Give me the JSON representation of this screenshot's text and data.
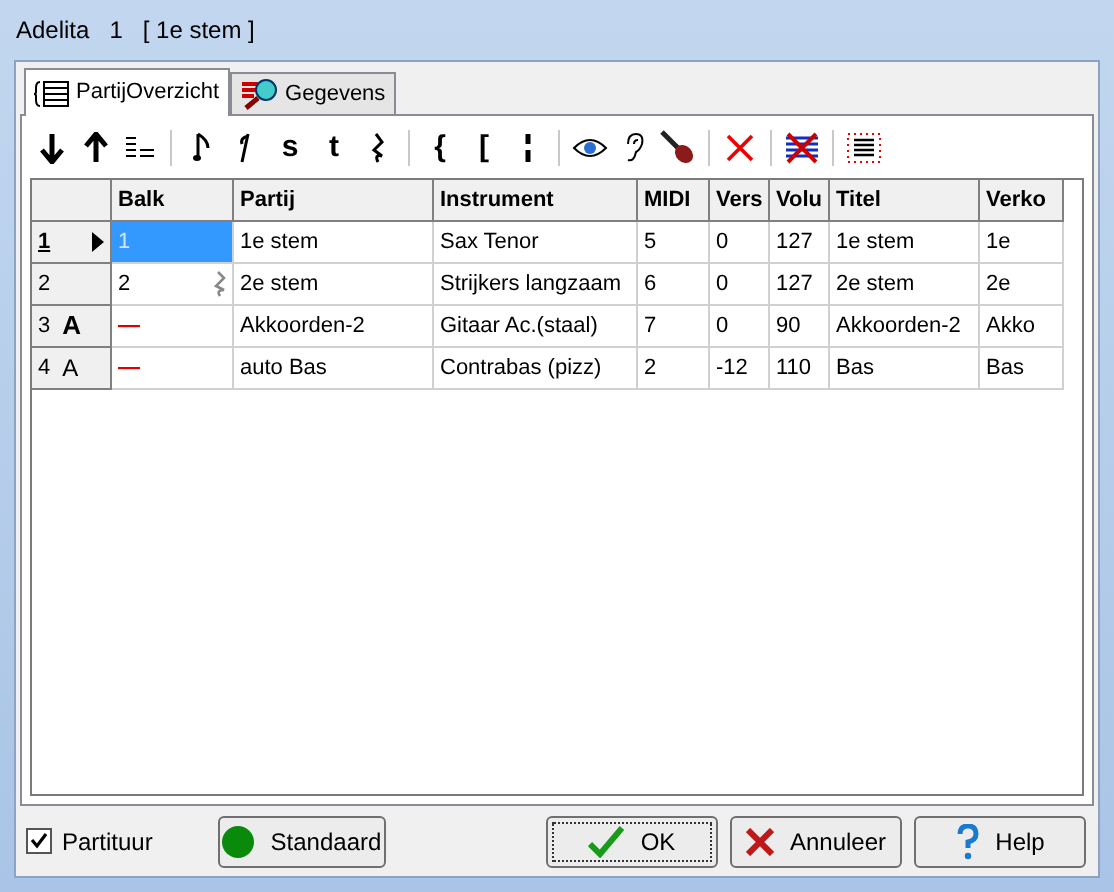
{
  "window": {
    "title": "Adelita   1   [ 1e stem ]"
  },
  "tabs": [
    {
      "label": "PartijOverzicht",
      "selected": true,
      "kind": "list"
    },
    {
      "label": "Gegevens",
      "selected": false,
      "kind": "data"
    }
  ],
  "toolbar": {
    "labels": [
      "s",
      "t",
      "{",
      "["
    ]
  },
  "table": {
    "columns": [
      "Balk",
      "Partij",
      "Instrument",
      "MIDI",
      "Vers",
      "Volu",
      "Titel",
      "Verko"
    ],
    "rows": [
      {
        "number": "1",
        "selected": true,
        "unset": false,
        "balk_selected": true,
        "rest": false,
        "cells": [
          "1",
          "1e stem",
          "Sax Tenor",
          "5",
          "0",
          "127",
          "1e stem",
          "1e"
        ]
      },
      {
        "number": "2",
        "selected": false,
        "unset": false,
        "balk_selected": false,
        "rest": true,
        "cells": [
          "2",
          "2e stem",
          "Strijkers langzaam",
          "6",
          "0",
          "127",
          "2e stem",
          "2e"
        ]
      },
      {
        "number": "3",
        "flag": "A",
        "flag_bold": true,
        "selected": false,
        "unset": true,
        "cells": [
          "—",
          "Akkoorden-2",
          "Gitaar Ac.(staal)",
          "7",
          "0",
          "90",
          "Akkoorden-2",
          "Akko"
        ]
      },
      {
        "number": "4",
        "flag": "A",
        "flag_bold": false,
        "selected": false,
        "unset": true,
        "cells": [
          "—",
          "auto Bas",
          "Contrabas (pizz)",
          "2",
          "-12",
          "110",
          "Bas",
          "Bas"
        ]
      }
    ]
  },
  "footer": {
    "checkbox": {
      "label": "Partituur",
      "checked": true
    },
    "buttons": [
      {
        "kind": "standard",
        "label": "Standaard"
      },
      {
        "kind": "ok",
        "label": "OK"
      },
      {
        "kind": "cancel",
        "label": "Annuleer"
      },
      {
        "kind": "help",
        "label": "Help"
      }
    ]
  }
}
